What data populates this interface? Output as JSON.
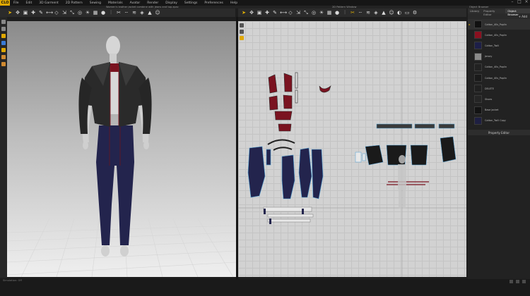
{
  "app": {
    "logo": "CLO",
    "menus": [
      "File",
      "Edit",
      "3D Garment",
      "2D Pattern",
      "Sewing",
      "Materials",
      "Avatar",
      "Render",
      "Display",
      "Settings",
      "Preferences",
      "Help"
    ],
    "file_title": "Women's leather jacket combine with jeans and top.zpac",
    "pattern_window_title": "2D Pattern Window",
    "object_browser_title": "Object Browser"
  },
  "toolbar3d": {
    "icons": [
      "cursor-icon",
      "transform-icon",
      "select-mesh-icon",
      "pin-icon",
      "tape-icon",
      "measure-icon",
      "fold-icon",
      "move-icon",
      "scale-icon",
      "camera-icon",
      "light-icon",
      "texture-icon",
      "button-icon",
      "zip-icon",
      "trim-icon",
      "topstitch-icon",
      "piping-icon",
      "fit-icon",
      "stress-icon",
      "avatar-icon"
    ]
  },
  "toolbar2d": {
    "icons": [
      "transform-pattern-icon",
      "edit-point-icon",
      "edit-curve-icon",
      "add-point-icon",
      "polygon-icon",
      "rectangle-icon",
      "ellipse-icon",
      "internal-line-icon",
      "dart-icon",
      "fold-arrangement-icon",
      "segment-sewing-icon",
      "free-sewing-icon",
      "check-sewing-icon",
      "edit-sewing-icon",
      "grain-icon",
      "fabric-icon",
      "seam-allowance-icon",
      "zoom-icon",
      "grid-icon",
      "text-icon",
      "measure-icon",
      "graphic-icon",
      "gear-icon"
    ]
  },
  "rightpanel": {
    "tabs": [
      "Library",
      "Property Editor",
      "Object Browser"
    ],
    "active_tab": "Object Browser",
    "header_label": "+ Add",
    "fabrics": [
      {
        "name": "Cotton_40s_Poplin",
        "color": "#111111",
        "selected": true
      },
      {
        "name": "Cotton_40s_Poplin",
        "color": "#8b1020",
        "selected": false
      },
      {
        "name": "Cotton_Twill",
        "color": "#1d1f48",
        "selected": false
      },
      {
        "name": "Jersey",
        "color": "#8a8a8a",
        "selected": false
      },
      {
        "name": "Cotton_40s_Poplin",
        "color": "#222222",
        "selected": false
      },
      {
        "name": "Cotton_40s_Poplin",
        "color": "#1a1a1a",
        "selected": false
      },
      {
        "name": "DELETE",
        "color": "#202020",
        "selected": false
      },
      {
        "name": "Shoes",
        "color": "#252525",
        "selected": false
      },
      {
        "name": "Base jacket",
        "color": "#131313",
        "selected": false
      },
      {
        "name": "Cotton_Twill Copy",
        "color": "#1e1f42",
        "selected": false
      }
    ],
    "bottom_panel_title": "Property Editor"
  },
  "status": {
    "text": "Simulation: Off"
  },
  "colors": {
    "leather": "#2a2a2a",
    "denim": "#23244d",
    "red": "#7a1320",
    "accent": "#e7b400"
  }
}
